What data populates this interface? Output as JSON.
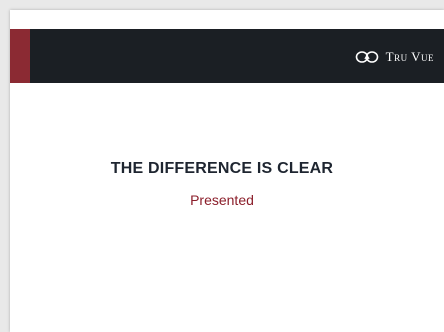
{
  "logo": {
    "brand": "Tru Vue"
  },
  "slide": {
    "title": "THE DIFFERENCE IS CLEAR",
    "subtitle": "Presented"
  },
  "colors": {
    "header_band": "#1b1f24",
    "accent": "#8b2a33",
    "title": "#1e2530",
    "subtitle": "#8b1e2a"
  }
}
